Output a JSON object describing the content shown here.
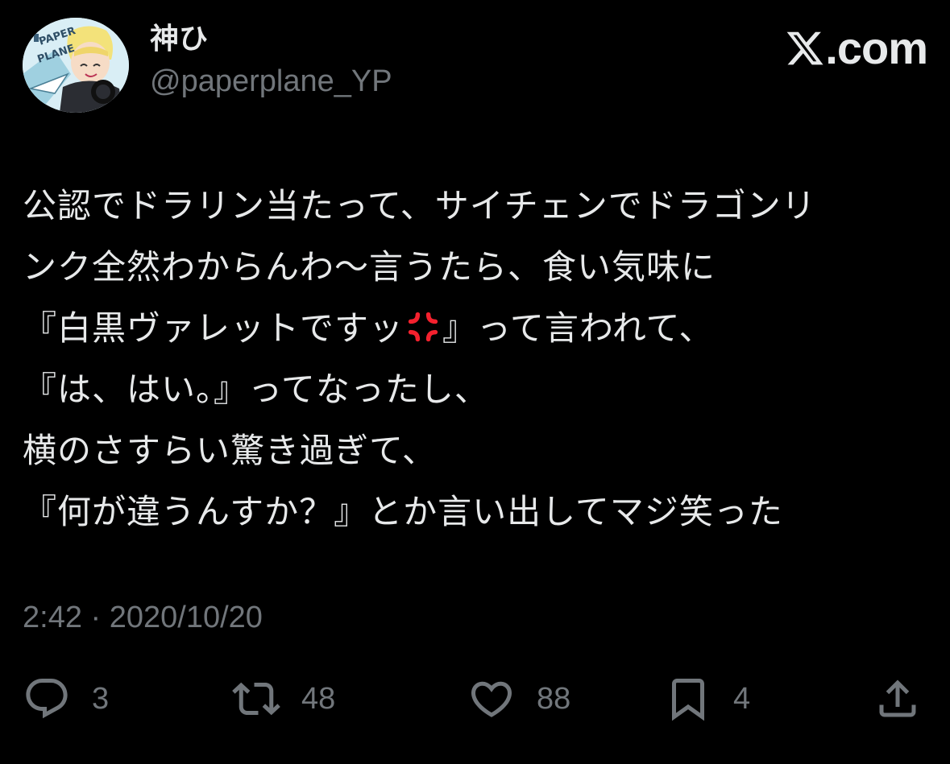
{
  "header": {
    "display_name": "神ひ",
    "handle": "@paperplane_YP",
    "brand_text": ".com",
    "avatar_text_1": "PAPER",
    "avatar_text_2": "PLANE"
  },
  "tweet": {
    "lines": [
      "公認でドラリン当たって、サイチェンでドラゴンリ",
      "ンク全然わからんわ〜言うたら、食い気味に",
      "『白黒ヴァレットですッ",
      "』って言われて、",
      "『は、はい。』ってなったし、",
      "横のさすらい驚き過ぎて、",
      "『何が違うんすか？』とか言い出してマジ笑った"
    ],
    "emoji": "anger-symbol"
  },
  "timestamp": "2:42 · 2020/10/20",
  "actions": {
    "reply_count": "3",
    "repost_count": "48",
    "like_count": "88",
    "bookmark_count": "4"
  },
  "colors": {
    "background": "#000000",
    "text": "#e7e9ea",
    "secondary": "#71767b",
    "anger": "#f4212e"
  }
}
